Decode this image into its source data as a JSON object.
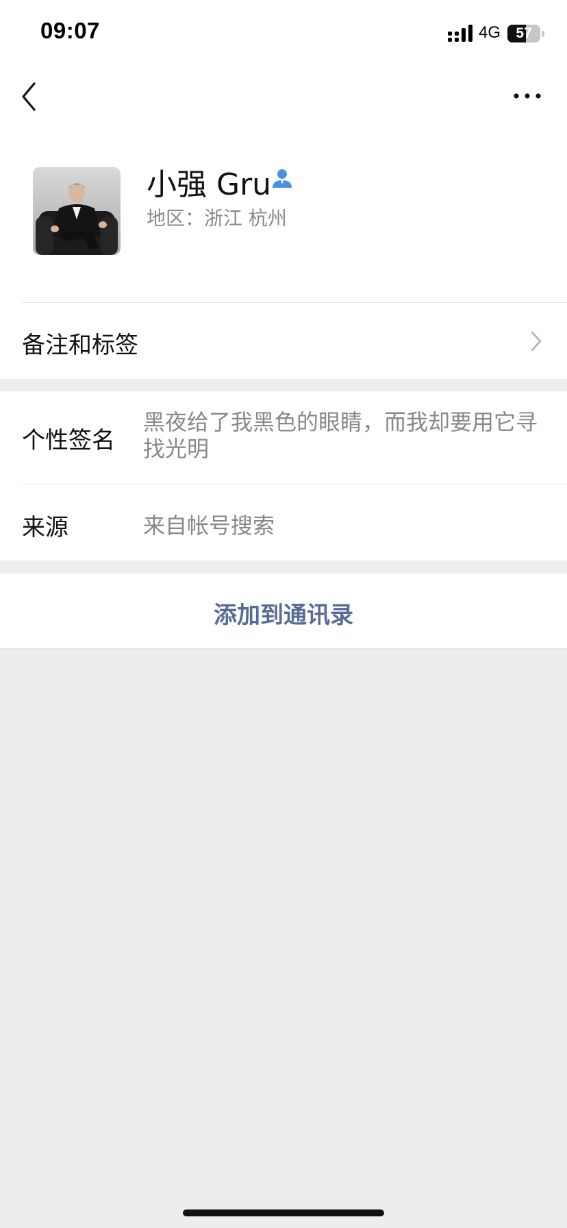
{
  "status_bar": {
    "time": "09:07",
    "network": "4G",
    "battery_level": "57",
    "battery_fraction": 0.57
  },
  "nav": {
    "back_icon": "chevron-left-icon",
    "more_icon": "more-dots-icon"
  },
  "profile": {
    "name": "小强 Gru",
    "name_icon": "person-icon",
    "region": "地区：浙江 杭州",
    "accent_color": "#4a90e2"
  },
  "remark_row": {
    "label": "备注和标签"
  },
  "signature_row": {
    "label": "个性签名",
    "value": "黑夜给了我黑色的眼睛，而我却要用它寻找光明"
  },
  "source_row": {
    "label": "来源",
    "value": "来自帐号搜索"
  },
  "action": {
    "add_label": "添加到通讯录",
    "link_color": "#576b95"
  }
}
